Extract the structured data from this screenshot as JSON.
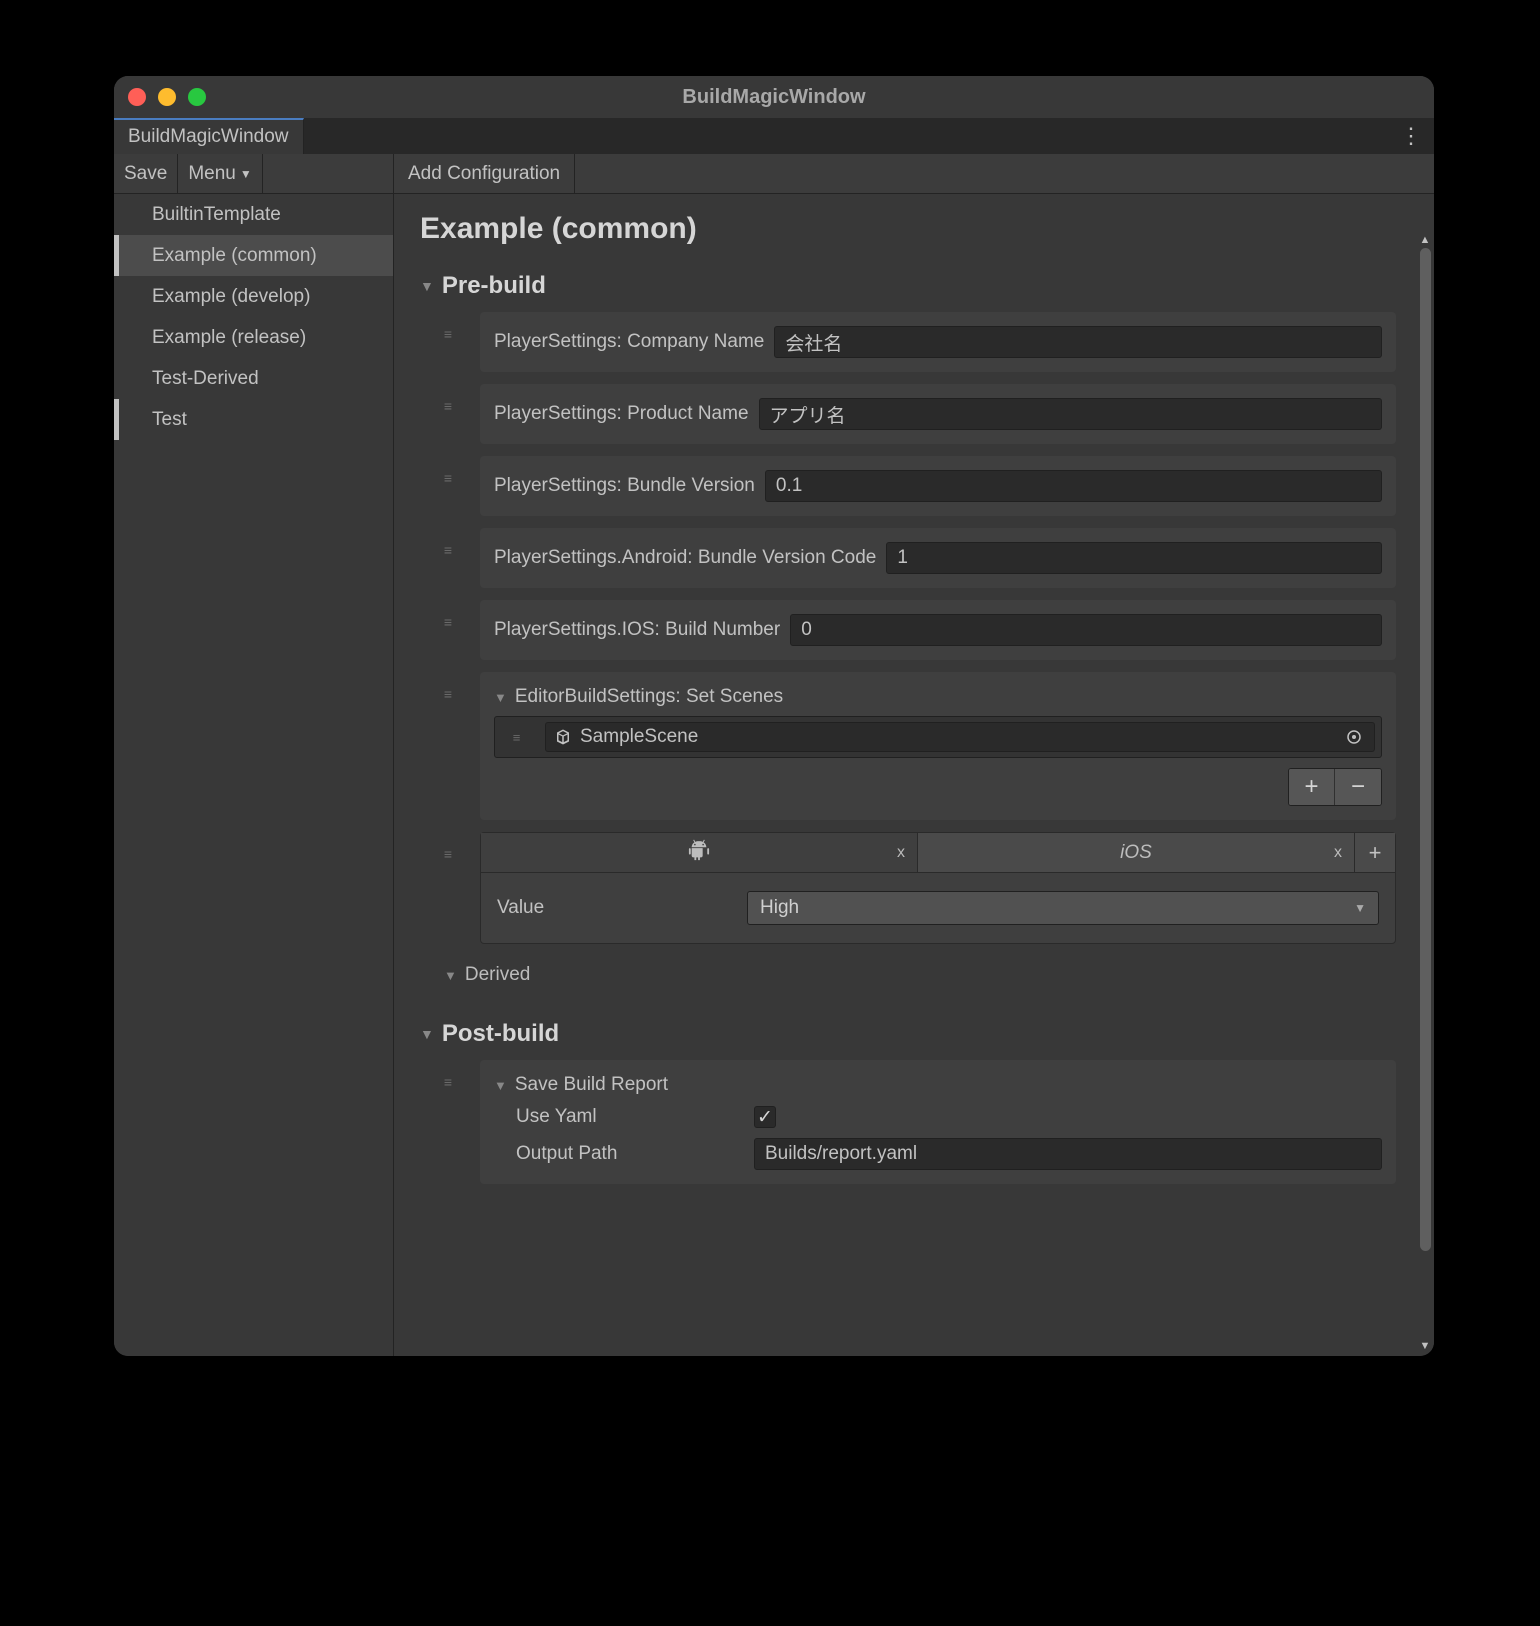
{
  "window_title": "BuildMagicWindow",
  "tab_label": "BuildMagicWindow",
  "toolbar": {
    "save": "Save",
    "menu": "Menu",
    "add_configuration": "Add Configuration"
  },
  "sidebar": {
    "items": [
      {
        "label": "BuiltinTemplate",
        "selected": false,
        "marked": false
      },
      {
        "label": "Example (common)",
        "selected": true,
        "marked": true
      },
      {
        "label": "Example (develop)",
        "selected": false,
        "marked": false
      },
      {
        "label": "Example (release)",
        "selected": false,
        "marked": false
      },
      {
        "label": "Test-Derived",
        "selected": false,
        "marked": false
      },
      {
        "label": "Test",
        "selected": false,
        "marked": true
      }
    ]
  },
  "page": {
    "title": "Example (common)",
    "prebuild_label": "Pre-build",
    "derived_label": "Derived",
    "postbuild_label": "Post-build",
    "fields": {
      "company_name": {
        "label": "PlayerSettings: Company Name",
        "value": "会社名"
      },
      "product_name": {
        "label": "PlayerSettings: Product Name",
        "value": "アプリ名"
      },
      "bundle_version": {
        "label": "PlayerSettings: Bundle Version",
        "value": "0.1"
      },
      "android_bvc": {
        "label": "PlayerSettings.Android: Bundle Version Code",
        "value": "1"
      },
      "ios_build_number": {
        "label": "PlayerSettings.IOS: Build Number",
        "value": "0"
      }
    },
    "set_scenes": {
      "label": "EditorBuildSettings: Set Scenes",
      "items": [
        {
          "name": "SampleScene"
        }
      ],
      "plus": "+",
      "minus": "−"
    },
    "platform": {
      "tabs": [
        {
          "id": "android",
          "label": "",
          "close": "x"
        },
        {
          "id": "ios",
          "label": "iOS",
          "close": "x"
        }
      ],
      "add": "+",
      "value_label": "Value",
      "value_selected": "High"
    },
    "postbuild": {
      "save_report_label": "Save Build Report",
      "use_yaml_label": "Use Yaml",
      "use_yaml_checked": true,
      "output_path_label": "Output Path",
      "output_path_value": "Builds/report.yaml"
    }
  }
}
